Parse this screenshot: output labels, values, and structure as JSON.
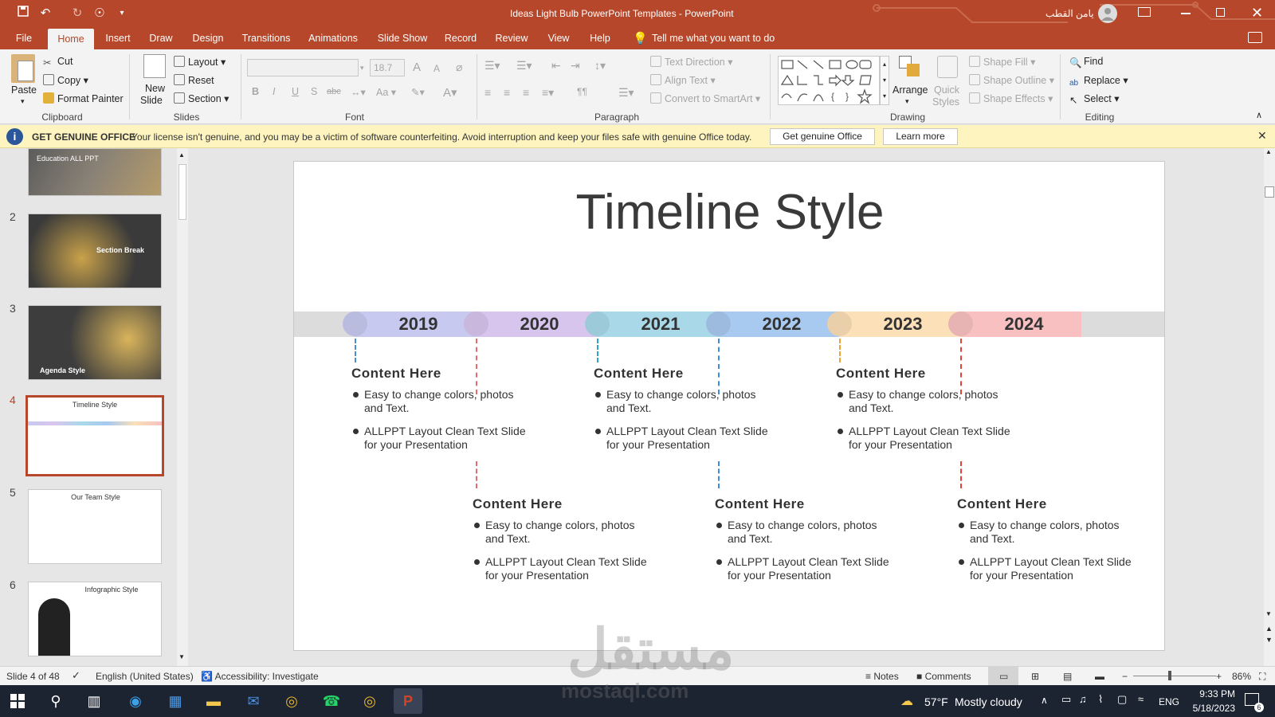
{
  "window": {
    "title": "Ideas Light Bulb PowerPoint Templates  -  PowerPoint",
    "user": "يامن القطب"
  },
  "quick_access": {
    "save": "save-icon",
    "undo": "undo-icon",
    "redo": "redo-icon",
    "touch": "touch-mode-icon",
    "more": "chevron-down-icon"
  },
  "tabs": [
    "File",
    "Home",
    "Insert",
    "Draw",
    "Design",
    "Transitions",
    "Animations",
    "Slide Show",
    "Record",
    "Review",
    "View",
    "Help"
  ],
  "tell_me": "Tell me what you want to do",
  "ribbon": {
    "clipboard": {
      "paste": "Paste",
      "cut": "Cut",
      "copy": "Copy",
      "format_painter": "Format Painter",
      "label": "Clipboard"
    },
    "slides": {
      "new_slide_1": "New",
      "new_slide_2": "Slide",
      "layout": "Layout",
      "reset": "Reset",
      "section": "Section",
      "label": "Slides"
    },
    "font": {
      "size": "18.7",
      "label": "Font",
      "bold": "B",
      "italic": "I",
      "underline": "U",
      "shadow": "S",
      "strike": "abc",
      "case": "Aa",
      "grow": "A",
      "shrink": "A"
    },
    "paragraph": {
      "text_direction": "Text Direction",
      "align_text": "Align Text",
      "smartart": "Convert to SmartArt",
      "label": "Paragraph"
    },
    "drawing": {
      "arrange": "Arrange",
      "quick_1": "Quick",
      "quick_2": "Styles",
      "shape_fill": "Shape Fill",
      "shape_outline": "Shape Outline",
      "shape_effects": "Shape Effects",
      "label": "Drawing"
    },
    "editing": {
      "find": "Find",
      "replace": "Replace",
      "select": "Select",
      "label": "Editing"
    }
  },
  "message_bar": {
    "title": "GET GENUINE OFFICE",
    "text": "Your license isn't genuine, and you may be a victim of software counterfeiting. Avoid interruption and keep your files safe with genuine Office today.",
    "button1": "Get genuine Office",
    "button2": "Learn more"
  },
  "thumbnails": [
    {
      "num": "",
      "text": "Education ALL PPT",
      "text2": ""
    },
    {
      "num": "2",
      "text": "Section Break",
      "text2": ""
    },
    {
      "num": "3",
      "text": "Agenda Style",
      "text2": ""
    },
    {
      "num": "4",
      "text": "Timeline Style",
      "text2": ""
    },
    {
      "num": "5",
      "text": "Our Team Style",
      "text2": ""
    },
    {
      "num": "6",
      "text": "Infographic Style",
      "text2": ""
    }
  ],
  "slide": {
    "title": "Timeline Style",
    "years": [
      "2019",
      "2020",
      "2021",
      "2022",
      "2023",
      "2024"
    ],
    "colors": [
      "#c7c9f0",
      "#d8c5ee",
      "#a9d9e8",
      "#a8c9f0",
      "#fbe0b8",
      "#f8c0c0"
    ],
    "blocks": [
      {
        "heading": "Content  Here",
        "b1": "Easy to change colors, photos and Text.",
        "b2": "ALLPPT Layout Clean Text Slide for your Presentation"
      },
      {
        "heading": "Content  Here",
        "b1": "Easy to change colors, photos and Text.",
        "b2": "ALLPPT Layout Clean Text Slide for your Presentation"
      },
      {
        "heading": "Content  Here",
        "b1": "Easy to change colors, photos and Text.",
        "b2": "ALLPPT Layout Clean Text Slide for your Presentation"
      },
      {
        "heading": "Content  Here",
        "b1": "Easy to change colors, photos and Text.",
        "b2": "ALLPPT Layout Clean Text Slide for your Presentation"
      },
      {
        "heading": "Content  Here",
        "b1": "Easy to change colors, photos and Text.",
        "b2": "ALLPPT Layout Clean Text Slide for your Presentation"
      },
      {
        "heading": "Content  Here",
        "b1": "Easy to change colors, photos and Text.",
        "b2": "ALLPPT Layout Clean Text Slide for your Presentation"
      }
    ]
  },
  "status": {
    "slide": "Slide 4 of 48",
    "language": "English (United States)",
    "accessibility": "Accessibility: Investigate",
    "notes": "Notes",
    "comments": "Comments",
    "zoom": "86%"
  },
  "taskbar": {
    "weather_temp": "57°F",
    "weather_text": "Mostly cloudy",
    "lang": "ENG",
    "time": "9:33 PM",
    "date": "5/18/2023",
    "notif": "6"
  },
  "watermark": {
    "ar": "مستقل",
    "en": "mostaql.com"
  }
}
